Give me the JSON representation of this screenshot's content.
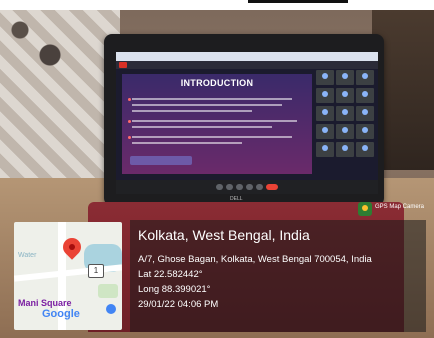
{
  "overlay": {
    "city": "Kolkata, West Bengal, India",
    "address": "A/7, Ghose Bagan, Kolkata, West Bengal 700054, India",
    "lat": "Lat 22.582442°",
    "long": "Long 88.399021°",
    "datetime": "29/01/22 04:06 PM"
  },
  "badge": {
    "label": "GPS Map Camera",
    "icon": "gps-map-camera-icon"
  },
  "slide": {
    "title": "INTRODUCTION"
  },
  "map": {
    "route_number": "1",
    "place_label": "Mani Square",
    "brand": "Google",
    "water_label": "Water"
  },
  "laptop": {
    "brand": "DELL"
  },
  "colors": {
    "pin": "#ea4335",
    "overlay": "#191919",
    "text": "#ffffff"
  }
}
